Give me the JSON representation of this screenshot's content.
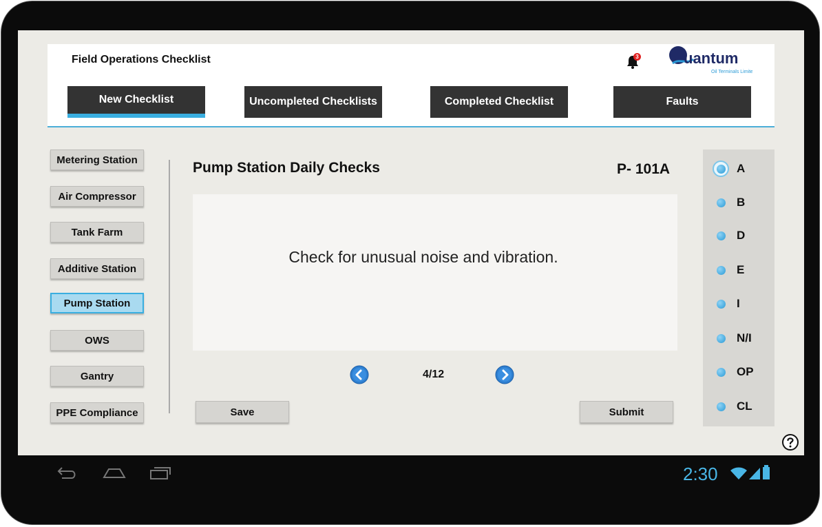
{
  "app": {
    "title": "Field Operations Checklist",
    "notification_count": "3",
    "logo_text": "Quantum",
    "logo_subtext": "Oil Terminals Limited"
  },
  "nav": {
    "tabs": [
      {
        "label": "New Checklist",
        "active": true
      },
      {
        "label": "Uncompleted Checklists",
        "active": false
      },
      {
        "label": "Completed Checklist",
        "active": false
      },
      {
        "label": "Faults",
        "active": false
      }
    ]
  },
  "sidebar": {
    "items": [
      {
        "label": "Metering Station",
        "active": false
      },
      {
        "label": "Air Compressor",
        "active": false
      },
      {
        "label": "Tank Farm",
        "active": false
      },
      {
        "label": "Additive Station",
        "active": false
      },
      {
        "label": "Pump Station",
        "active": true
      },
      {
        "label": "OWS",
        "active": false
      },
      {
        "label": "Gantry",
        "active": false
      },
      {
        "label": "PPE Compliance",
        "active": false
      }
    ]
  },
  "main": {
    "title": "Pump Station Daily Checks",
    "code": "P- 101A",
    "question": "Check for unusual noise and vibration.",
    "pager": "4/12",
    "save_label": "Save",
    "submit_label": "Submit"
  },
  "options": {
    "selected": "A",
    "items": [
      "A",
      "B",
      "D",
      "E",
      "I",
      "N/I",
      "OP",
      "CL"
    ]
  },
  "status": {
    "time": "2:30"
  },
  "colors": {
    "accent": "#3aaee0",
    "nav_bg": "#333333",
    "badge": "#e02020"
  }
}
